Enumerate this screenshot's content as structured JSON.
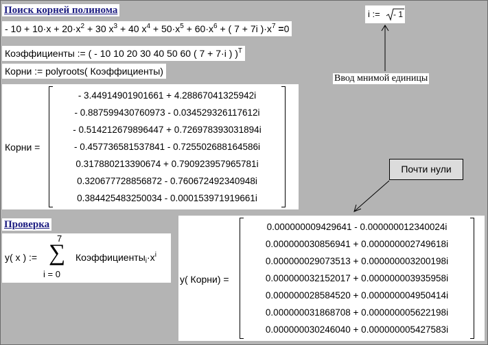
{
  "section1": {
    "title": "Поиск корней полинома",
    "equation": {
      "prefix": "- 10 + 10·x + 20·x",
      "e2": "2",
      "t3": " + 30 x",
      "e3": "3",
      "t4": " + 40 x",
      "e4": "4",
      "t5": " + 50·x",
      "e5": "5",
      "t6": " + 60·x",
      "e6": "6",
      "t7": " + ( 7 + 7i )·x",
      "e7": "7",
      "eq": " =",
      "rhs": "0"
    },
    "coeffs_def": "Коэффициенты := ( - 10   10   20   30   40   50   60   ( 7 + 7·i ) )",
    "coeffs_sup": "T",
    "roots_def": "Корни := polyroots( Коэффициенты)",
    "roots_label": "Корни =",
    "roots": [
      "- 3.44914901901661 + 4.28867041325942i",
      "- 0.887599430760973 - 0.034529326117612i",
      "- 0.514212679896447 + 0.726978393031894i",
      "- 0.457736581537841 - 0.725502688164586i",
      "0.317880213390674 + 0.790923957965781i",
      "0.320677728856872 - 0.760672492340948i",
      "0.384425483250034 - 0.000153971919661i"
    ]
  },
  "imag_unit": {
    "def_left": "i :=",
    "def_radicand": "- 1",
    "callout": "Ввод мнимой единицы"
  },
  "near_zero": {
    "label": "Почти нули"
  },
  "section2": {
    "title": "Проверка",
    "func_left": "y( x ) :=",
    "sum_top": "7",
    "sum_symbol": "∑",
    "sum_bottom": "i = 0",
    "sum_body": "Коэффициенты",
    "sum_sub": "i",
    "sum_x": "·x",
    "sum_sup": "i",
    "check_label": "y( Корни)  =",
    "values": [
      "0.000000009429641 - 0.000000012340024i",
      "0.000000030856941 + 0.000000002749618i",
      "0.000000029073513 + 0.000000003200198i",
      "0.000000032152017 + 0.000000003935958i",
      "0.000000028584520 + 0.000000004950414i",
      "0.000000031868708 + 0.000000005622198i",
      "0.000000030246040 + 0.000000005427583i"
    ]
  }
}
